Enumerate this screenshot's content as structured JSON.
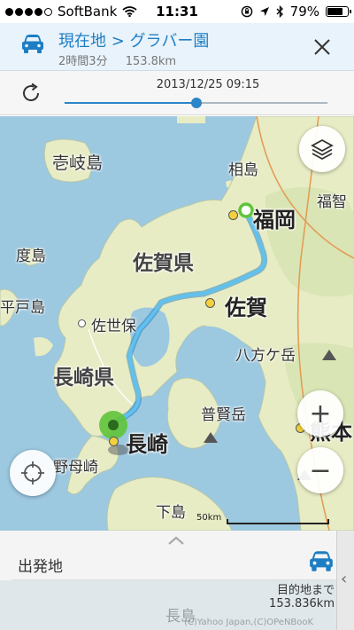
{
  "status_bar": {
    "carrier": "SoftBank",
    "signal_filled": 4,
    "signal_total": 5,
    "time": "11:31",
    "battery_text": "79%",
    "battery_level": 0.79
  },
  "route": {
    "title": "現在地 > グラバー園",
    "duration": "2時間3分",
    "distance": "153.8km",
    "transport_icon": "car-icon",
    "close_icon": "close-icon"
  },
  "timeline": {
    "timestamp": "2013/12/25 09:15",
    "progress": 0.5
  },
  "map": {
    "labels": {
      "iki": "壱岐島",
      "ainoshima": "相島",
      "fukuoka": "福岡",
      "fukuma": "福智",
      "saga_pref": "佐賀県",
      "tokushima": "度島",
      "hiradojima": "平戸島",
      "saga": "佐賀",
      "sasebo": "佐世保",
      "nagasaki_pref": "長崎県",
      "hakkagatake": "八方ケ岳",
      "fugendake": "普賢岳",
      "nagasaki": "長崎",
      "nomozaki": "野母崎",
      "shimojima": "下島",
      "kumamoto": "熊本"
    },
    "scale_label": "50km",
    "layers_icon": "layers-icon",
    "locate_icon": "crosshair-icon",
    "zoom_in": "+",
    "zoom_out": "−",
    "colors": {
      "sea": "#9cc8e0",
      "land": "#e7ecc4",
      "route": "#33a3e0",
      "start_pin": "#5fc43a"
    }
  },
  "panel": {
    "origin_label": "出発地",
    "dest_label": "目的地まで",
    "dest_distance": "153.836km",
    "bottom_place": "長島",
    "copyright": "(C)Yahoo Japan,(C)OPeNBooK"
  }
}
